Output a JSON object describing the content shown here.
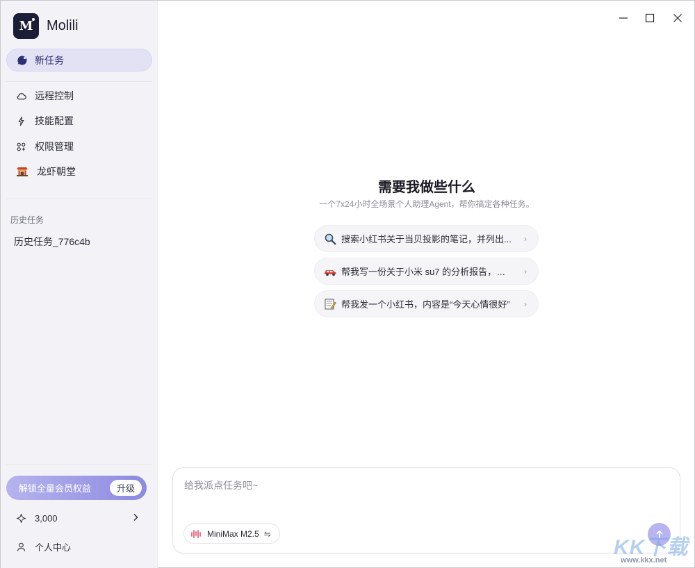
{
  "app": {
    "name": "Molili",
    "logo_text": "M"
  },
  "sidebar": {
    "new_task": "新任务",
    "items": [
      {
        "label": "远程控制",
        "icon": "cloud-icon"
      },
      {
        "label": "技能配置",
        "icon": "bolt-icon"
      },
      {
        "label": "权限管理",
        "icon": "apps-icon"
      },
      {
        "label": "龙虾朝堂",
        "icon": "temple-icon"
      }
    ],
    "history_title": "历史任务",
    "history": [
      "历史任务_776c4b"
    ],
    "upgrade_text": "解锁全量会员权益",
    "upgrade_button": "升级",
    "credits": "3,000",
    "profile": "个人中心"
  },
  "main": {
    "heading": "需要我做些什么",
    "subtitle": "一个7x24小时全场景个人助理Agent，帮你搞定各种任务。",
    "suggestions": [
      {
        "label": "搜索小红书关于当贝投影的笔记，并列出...",
        "icon": "magnifier-icon"
      },
      {
        "label": "帮我写一份关于小米 su7 的分析报告，以 ...",
        "icon": "car-icon"
      },
      {
        "label": "帮我发一个小红书，内容是“今天心情很好”",
        "icon": "memo-icon"
      }
    ]
  },
  "composer": {
    "placeholder": "给我派点任务吧~",
    "model": "MiniMax M2.5",
    "switch_glyph": "⇋"
  },
  "watermark": {
    "main": "KK下载",
    "url": "www.kkx.net"
  },
  "colors": {
    "accent": "#8d8ae0",
    "sidebar_bg": "#f3f3f7",
    "send": "#b7b4ef"
  }
}
